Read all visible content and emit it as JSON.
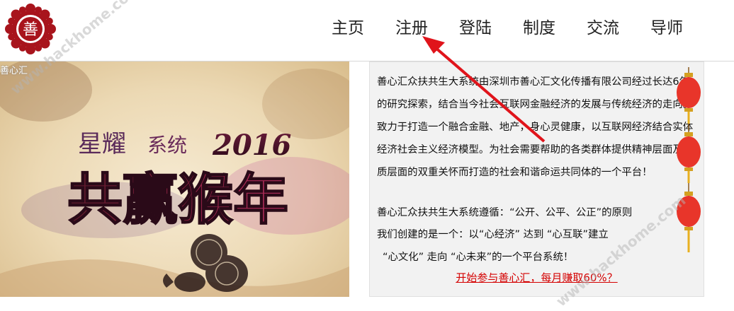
{
  "nav": {
    "items": [
      "主页",
      "注册",
      "登陆",
      "制度",
      "交流",
      "导师"
    ]
  },
  "logo": {
    "glyph": "善"
  },
  "banner": {
    "corner_label": "善心汇",
    "line1": "星耀",
    "line1b": "系统",
    "year": "2016",
    "headline": "共赢猴年"
  },
  "panel": {
    "paragraph1": "善心汇众扶共生大系统由深圳市善心汇文化传播有限公司经过长达6年的研究探索，结合当今社会互联网金融经济的发展与传统经济的走向。致力于打造一个融合金融、地产，身心灵健康，以互联网经济结合实体经济社会主义经济模型。为社会需要帮助的各类群体提供精神层面及物质层面的双重关怀而打造的社会和谐命运共同体的一个平台！",
    "paragraph2": "善心汇众扶共生大系统遵循：“公开、公平、公正”的原则",
    "paragraph3": "我们创建的是一个：以“心经济” 达到 “心互联”建立",
    "paragraph4": "“心文化” 走向 “心未来”的一个平台系统！",
    "cta": "开始参与善心汇，每月赚取60%？"
  },
  "watermark": {
    "text": "www.hackhome.com"
  },
  "colors": {
    "arrow": "#e0141b",
    "cta": "#d40000",
    "logo": "#a8141c"
  }
}
